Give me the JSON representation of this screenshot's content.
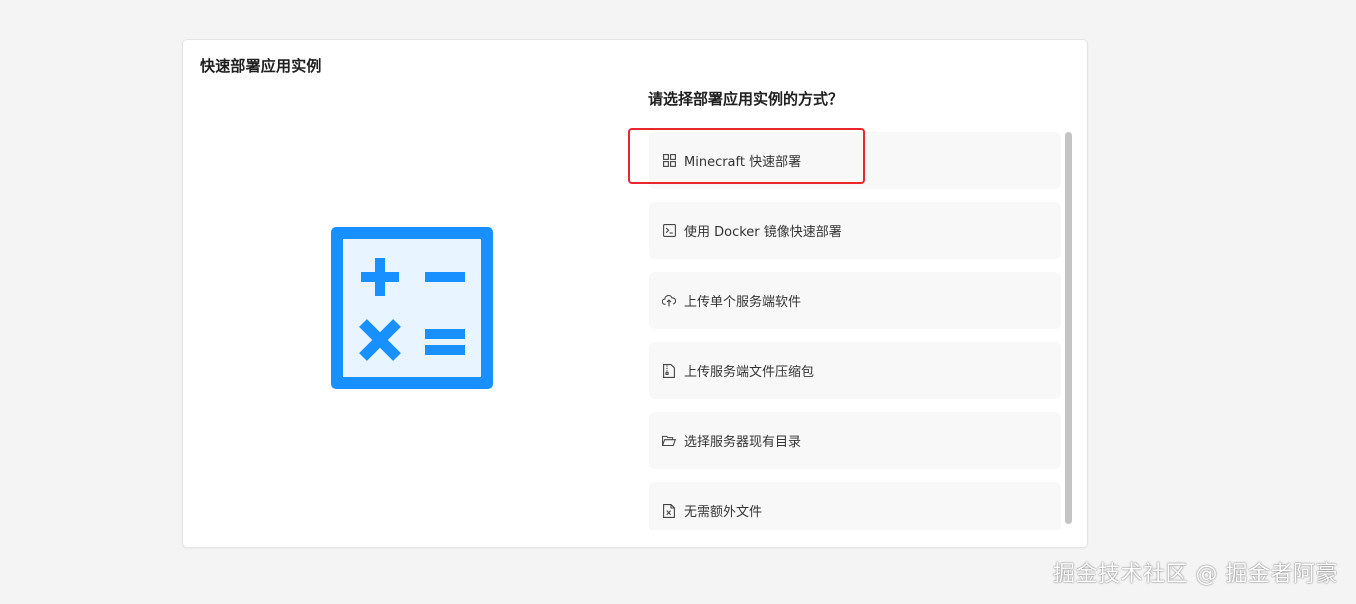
{
  "card": {
    "title": "快速部署应用实例"
  },
  "hero": {
    "icon": "calculator-icon",
    "color": "#1890ff"
  },
  "question": "请选择部署应用实例的方式？",
  "options": [
    {
      "icon": "apps-icon",
      "label": "Minecraft 快速部署"
    },
    {
      "icon": "terminal-icon",
      "label": "使用 Docker 镜像快速部署"
    },
    {
      "icon": "cloud-upload-icon",
      "label": "上传单个服务端软件"
    },
    {
      "icon": "zip-file-icon",
      "label": "上传服务端文件压缩包"
    },
    {
      "icon": "folder-open-icon",
      "label": "选择服务器现有目录"
    },
    {
      "icon": "blank-file-icon",
      "label": "无需额外文件"
    }
  ],
  "highlight_color": "#e8262b",
  "watermark": "掘金技术社区 @ 掘金者阿豪"
}
